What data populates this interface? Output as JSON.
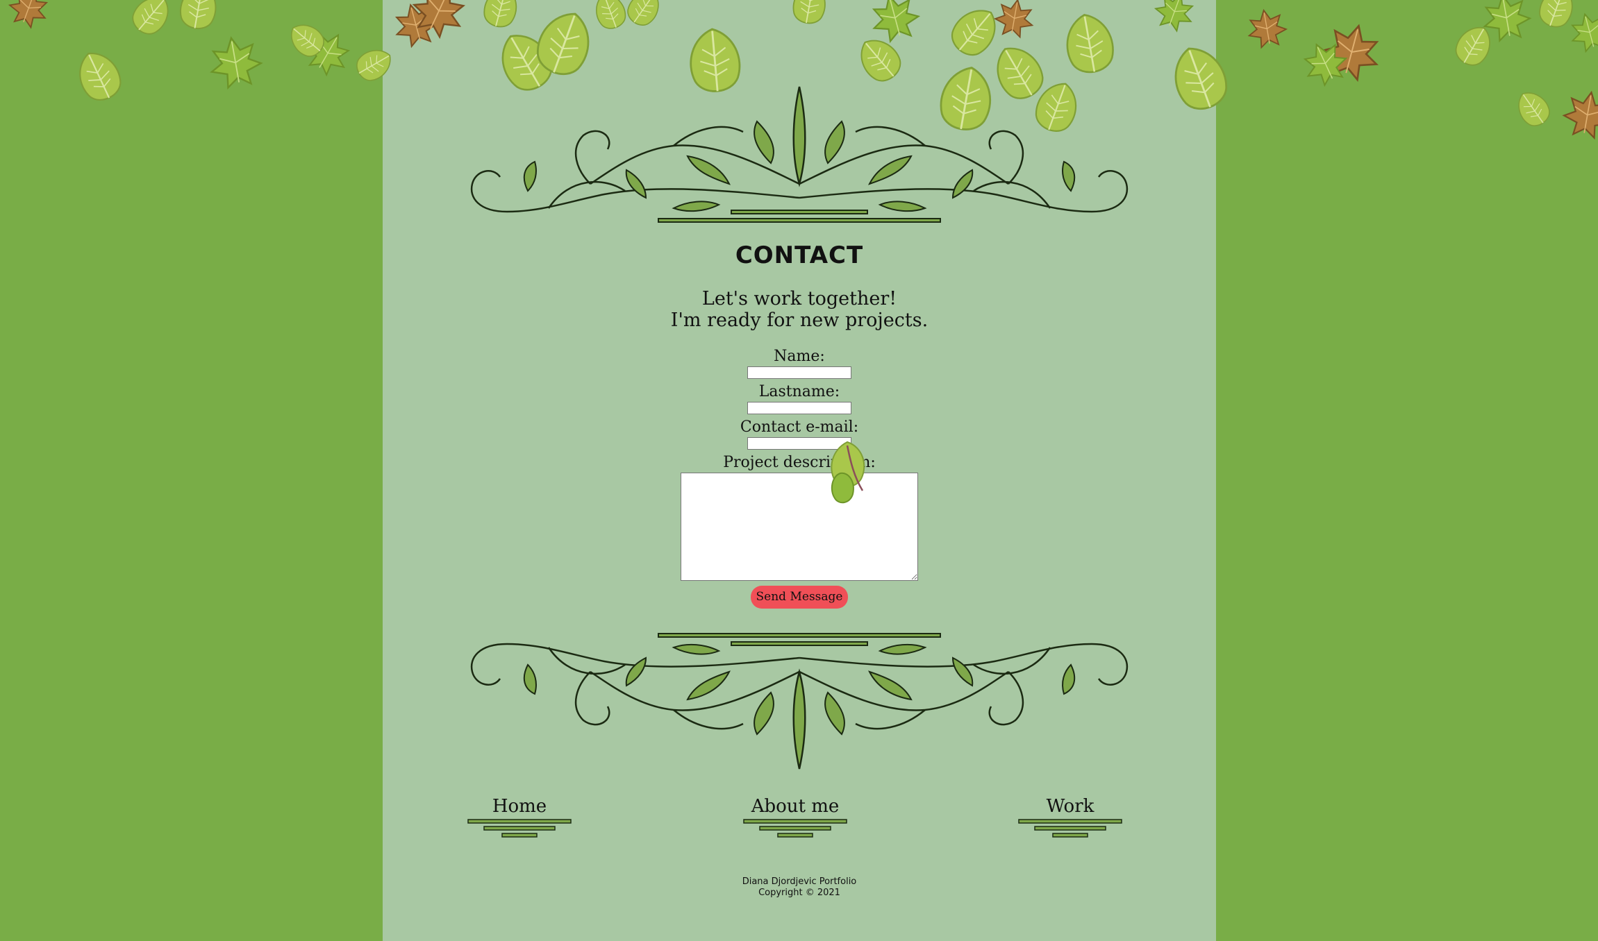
{
  "contact": {
    "title": "CONTACT",
    "intro_line1": "Let's work together!",
    "intro_line2": "I'm ready for new projects."
  },
  "form": {
    "name_label": "Name:",
    "name_value": "",
    "lastname_label": "Lastname:",
    "lastname_value": "",
    "email_label": "Contact e-mail:",
    "email_value": "",
    "description_label": "Project description:",
    "description_value": "",
    "send_label": "Send Message"
  },
  "nav": {
    "items": [
      {
        "label": "Home"
      },
      {
        "label": "About me"
      },
      {
        "label": "Work"
      }
    ]
  },
  "footer": {
    "line1": "Diana Djordjevic Portfolio",
    "line2": "Copyright © 2021"
  },
  "theme": {
    "outer_green": "#79ad47",
    "column_green": "#a8c8a3",
    "button_red": "#f04f57",
    "vine_dark": "#1b2a12",
    "vine_light": "#7fa84a"
  },
  "icons": [
    "leaf-icon",
    "vine-ornament-icon"
  ]
}
